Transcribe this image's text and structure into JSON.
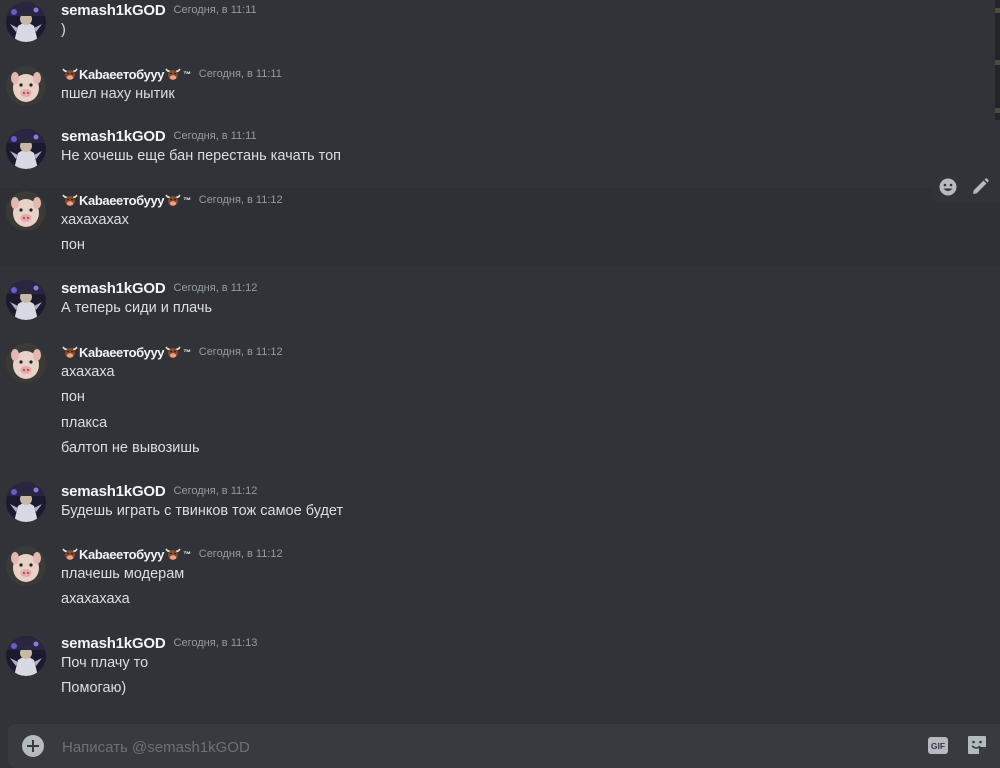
{
  "colors": {
    "background": "#313338",
    "composer": "#383a40",
    "text": "#dbdee1",
    "username": "#f2f3f5",
    "timestamp": "#949ba4"
  },
  "users": {
    "semash": "semash1kGOD",
    "kabanchik": "꒰ꕤ;ʚɞ_ҡǟɮǟǟɛȶօɮʊʏʏ꒱"
  },
  "messages": [
    {
      "author": "semash1kGOD",
      "timestamp": "Сегодня, в 11:11",
      "lines": [
        ")"
      ]
    },
    {
      "author": "kabanchik",
      "timestamp": "Сегодня, в 11:11",
      "lines": [
        "пшел наху нытик"
      ]
    },
    {
      "author": "semash1kGOD",
      "timestamp": "Сегодня, в 11:11",
      "lines": [
        "Не хочешь еще бан перестань качать топ"
      ]
    },
    {
      "author": "kabanchik",
      "timestamp": "Сегодня, в 11:12",
      "lines": [
        "хахахахах",
        "пон"
      ]
    },
    {
      "author": "semash1kGOD",
      "timestamp": "Сегодня, в 11:12",
      "lines": [
        "А теперь сиди и плачь"
      ]
    },
    {
      "author": "kabanchik",
      "timestamp": "Сегодня, в 11:12",
      "lines": [
        "ахахаха",
        "пон",
        "плакса",
        "балтоп не вывозишь"
      ]
    },
    {
      "author": "semash1kGOD",
      "timestamp": "Сегодня, в 11:12",
      "lines": [
        "Будешь играть с твинков тож самое будет"
      ]
    },
    {
      "author": "kabanchik",
      "timestamp": "Сегодня, в 11:12",
      "lines": [
        "плачешь модерам",
        "ахахахаха"
      ]
    },
    {
      "author": "semash1kGOD",
      "timestamp": "Сегодня, в 11:13",
      "lines": [
        "Поч плачу то",
        "Помогаю)"
      ]
    }
  ],
  "fancy_name": {
    "text": "Kabaeeтобуyy",
    "tm": "™",
    "left_emoji": "bull-face-icon",
    "right_emoji": "bull-face-icon"
  },
  "toolbar": {
    "icons": [
      "emoji-icon",
      "pencil-icon"
    ]
  },
  "composer": {
    "placeholder": "Написать @semash1kGOD",
    "gif_label": "GIF",
    "icons": [
      "plus-icon",
      "sticker-icon"
    ]
  }
}
